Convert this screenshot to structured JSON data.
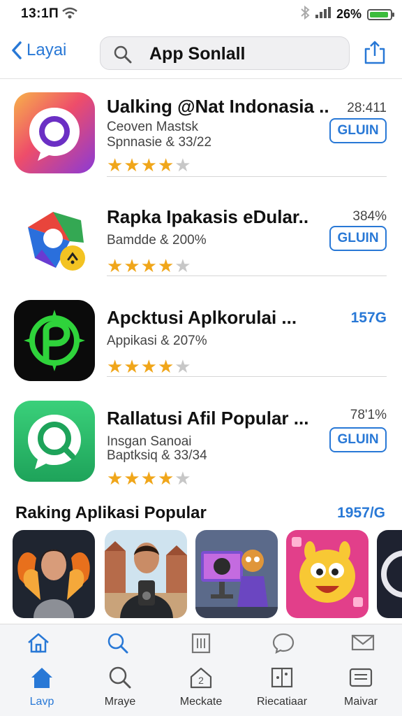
{
  "status_bar": {
    "time": "13:1Π",
    "battery_pct": "26%"
  },
  "nav": {
    "back_label": "Layai",
    "search_text": "App Sonlall"
  },
  "apps": [
    {
      "title": "Ualking @Nat Indonasia ..",
      "sub1": "Ceoven Mastsk",
      "sub2": "Spnnasie & 33/22",
      "size": "28:411",
      "button": "GLUIN",
      "rating": 4
    },
    {
      "title": "Rapka Ipakasis eDular..",
      "sub1": "Bamdde & 200%",
      "sub2": "",
      "size": "384%",
      "button": "GLUIN",
      "rating": 4
    },
    {
      "title": "Apcktusi Aplkorulai ...",
      "sub1": "Appikasi & 207%",
      "sub2": "",
      "size": "157G",
      "button": "",
      "rating": 4
    },
    {
      "title": "Rallatusi Afil Popular ...",
      "sub1": "Insgan Sanoai",
      "sub2": "Baptksiq & 33/34",
      "size": "78'1%",
      "button": "GLUIN",
      "rating": 4
    }
  ],
  "ranking": {
    "title": "Raking Aplikasi Popular",
    "more": "1957/G"
  },
  "tabbar_top": [
    "home-icon",
    "search-icon",
    "building-icon",
    "chat-icon",
    "mail-icon"
  ],
  "tabbar_bottom": [
    {
      "label": "Lavp",
      "icon": "home-icon"
    },
    {
      "label": "Mraye",
      "icon": "search-icon"
    },
    {
      "label": "Meckate",
      "icon": "house-icon"
    },
    {
      "label": "Riecatiaar",
      "icon": "grid-icon"
    },
    {
      "label": "Maivar",
      "icon": "message-icon"
    }
  ],
  "colors": {
    "accent": "#2878d6",
    "star": "#f0a61a",
    "star_off": "#c7c7c7",
    "battery": "#3cbc3c"
  }
}
